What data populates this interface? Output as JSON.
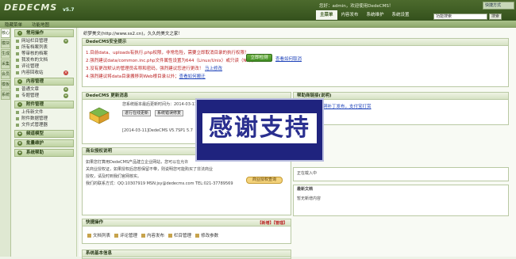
{
  "app": {
    "logo_text": "DEDECMS",
    "version": "v5.7"
  },
  "topbar": {
    "user_info": "您好：admin，欢迎使用DedeCMS！",
    "nav_tabs": [
      "主菜单",
      "内容发布",
      "系统维护",
      "系统设置",
      "生成",
      "采集",
      "会员",
      "模板"
    ],
    "skin_label": "快捷方式"
  },
  "subbar": {
    "hide_menu": "隐藏菜单",
    "site_map": "功能地图",
    "search_placeholder": "功能搜索",
    "search_btn": "搜索"
  },
  "vtabs": [
    "核心",
    "模块",
    "生成",
    "采集",
    "会员",
    "模板",
    "系统"
  ],
  "menu": {
    "groups": [
      {
        "title": "常用操作",
        "items": [
          "网站栏目管理",
          "所有档案列表",
          "等审核的档案",
          "我发布的文档",
          "评论管理",
          "内容回收站"
        ]
      },
      {
        "title": "内容管理",
        "items": [
          "普通文章",
          "专题管理"
        ]
      },
      {
        "title": "附件管理",
        "items": [
          "上传新文件",
          "附件数据管理",
          "文件式管理器"
        ]
      },
      {
        "title": "频道模型",
        "items": []
      },
      {
        "title": "批量维护",
        "items": []
      },
      {
        "title": "系统帮助",
        "items": []
      }
    ]
  },
  "main": {
    "greeting": "织梦美文(http://www.ss2.cn)，久久的美文之家！",
    "security_panel": {
      "title": "DedeCMS安全提示",
      "tips": [
        "1.目前data、uploads有执行.php权限，非常危险，需要立即取消目录的执行权限！",
        "2.强烈建议data/common.inc.php文件属性设置为644（Linux/Unix）或只读（NT）；",
        "3.没有更改默认的管理员名称和密码，强烈建议您进行更改！",
        "4.强烈建议将data目录搬移到Web根目录以外；"
      ],
      "check_btn": "立即检测",
      "cancel_link": "查看如何取消",
      "change_link": "马上修改",
      "move_link": "查看如何搬迁"
    },
    "update_panel": {
      "title": "DedeCMS 更新消息",
      "latest": "您系统版本最后更新时间为：2014-03-11",
      "btn_check": "进行在线更新",
      "btn_history": "系统错误修复",
      "version_line": "[2014-03-11]DedeCMS V5.7SP1 5.7"
    },
    "help_panel": {
      "title": "帮助商链接(说明)",
      "links": "最新软件、漏洞补丁发布，支付宝打赏"
    },
    "license_panel": {
      "title": "商业授权说明",
      "line1": "如果您打算用DedeCMS产品建立企业网站，您可以在允许",
      "line2": "关商业授权证，如果授权后您想保留不带，则说明您可能购买了非法商业",
      "line3": "授权，请及时到我们官网核实。",
      "contact": "我们的联系方式：QQ:10307919 MSN:jsy@dedecms.com TEL:021-37789569",
      "query_btn": "商业授权查询"
    },
    "info_panel": {
      "line1": "正在载入中",
      "latest_title": "最新文档",
      "latest_text": "暂无新增内容"
    },
    "quick_panel": {
      "title": "快捷操作",
      "manage": "【新增】【管理】",
      "items": [
        "文档列表",
        "评论管理",
        "内容发布",
        "栏目管理",
        "修改参数"
      ]
    },
    "sysinfo_title": "系统基本信息",
    "overlay_text": "感谢支持"
  }
}
